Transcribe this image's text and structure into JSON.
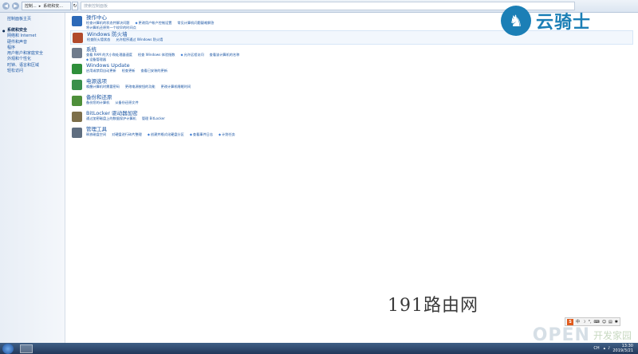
{
  "address": {
    "crumbs": [
      "控制...",
      "系统和安..."
    ],
    "search_placeholder": "搜索控制面板"
  },
  "sidebar": {
    "title": "控制面板主页",
    "items": [
      {
        "label": "系统和安全",
        "active": true
      },
      {
        "label": "网络和 Internet"
      },
      {
        "label": "硬件和声音"
      },
      {
        "label": "程序"
      },
      {
        "label": "用户帐户和家庭安全"
      },
      {
        "label": "外观和个性化"
      },
      {
        "label": "时钟、语言和区域"
      },
      {
        "label": "轻松访问"
      }
    ]
  },
  "categories": [
    {
      "id": "action",
      "title": "操作中心",
      "links": [
        "检查计算机的状态并解决问题",
        "更改用户帐户控制设置",
        "常见计算机问题疑难解答",
        "将计算机还原到一个较早的时间点"
      ]
    },
    {
      "id": "firewall",
      "title": "Windows 防火墙",
      "links": [
        "检查防火墙状态",
        "允许程序通过 Windows 防火墙"
      ],
      "highlight": true
    },
    {
      "id": "system",
      "title": "系统",
      "links": [
        "查看 RAM 的大小和处理器速度",
        "检查 Windows 体验指数",
        "允许远程访问",
        "查看该计算机的名称",
        "设备管理器"
      ]
    },
    {
      "id": "update",
      "title": "Windows Update",
      "links": [
        "启用或禁用自动更新",
        "检查更新",
        "查看已安装的更新"
      ]
    },
    {
      "id": "power",
      "title": "电源选项",
      "links": [
        "唤醒计算机时需要密码",
        "更改电源按钮的功能",
        "更改计算机睡眠时间"
      ]
    },
    {
      "id": "backup",
      "title": "备份和还原",
      "links": [
        "备份您的计算机",
        "从备份还原文件"
      ]
    },
    {
      "id": "bitlocker",
      "title": "BitLocker 驱动器加密",
      "links": [
        "通过加密磁盘上的数据保护计算机",
        "管理 BitLocker"
      ]
    },
    {
      "id": "admin",
      "title": "管理工具",
      "links": [
        "释放磁盘空间",
        "对硬盘进行碎片整理",
        "创建并格式化硬盘分区",
        "查看事件日志",
        "计划任务"
      ]
    }
  ],
  "logo": {
    "text": "云骑士"
  },
  "watermark_center": "191路由网",
  "watermark_br": {
    "brand": "OPEN",
    "cn": "开发家园"
  },
  "ime": {
    "s": "S",
    "lang": "中"
  },
  "taskbar": {
    "ch": "CH",
    "time": "13:30",
    "date": "2019/3/21"
  }
}
